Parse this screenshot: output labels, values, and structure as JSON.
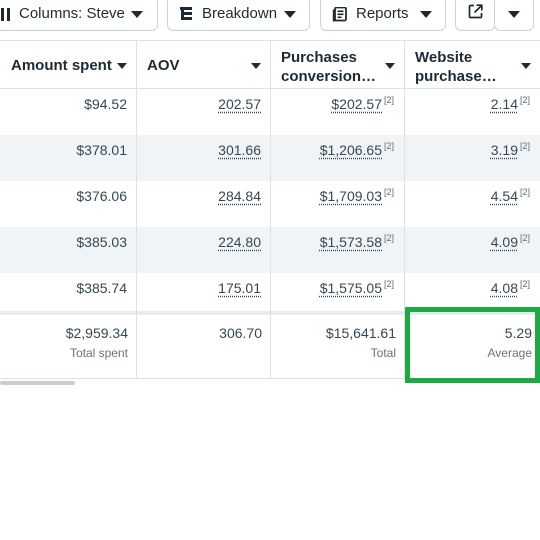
{
  "toolbar": {
    "columns_label": "Columns: Steve",
    "breakdown_label": "Breakdown",
    "reports_label": "Reports",
    "export_icon": "external-link-icon",
    "more_icon": "caret-down-icon"
  },
  "table": {
    "columns": [
      {
        "line1": "Amount spent",
        "line2": ""
      },
      {
        "line1": "AOV",
        "line2": ""
      },
      {
        "line1": "Purchases",
        "line2": "conversion…"
      },
      {
        "line1": "Website",
        "line2": "purchase…"
      }
    ],
    "rows": [
      {
        "amount": "$94.52",
        "aov": "202.57",
        "conv": "$202.57",
        "conv_note": "[2]",
        "web": "2.14",
        "web_note": "[2]"
      },
      {
        "amount": "$378.01",
        "aov": "301.66",
        "conv": "$1,206.65",
        "conv_note": "[2]",
        "web": "3.19",
        "web_note": "[2]"
      },
      {
        "amount": "$376.06",
        "aov": "284.84",
        "conv": "$1,709.03",
        "conv_note": "[2]",
        "web": "4.54",
        "web_note": "[2]"
      },
      {
        "amount": "$385.03",
        "aov": "224.80",
        "conv": "$1,573.58",
        "conv_note": "[2]",
        "web": "4.09",
        "web_note": "[2]"
      },
      {
        "amount": "$385.74",
        "aov": "175.01",
        "conv": "$1,575.05",
        "conv_note": "[2]",
        "web": "4.08",
        "web_note": "[2]"
      }
    ],
    "summary": {
      "amount": "$2,959.34",
      "amount_sub": "Total spent",
      "aov": "306.70",
      "conv": "$15,641.61",
      "conv_sub": "Total",
      "web": "5.29",
      "web_sub": "Average"
    }
  },
  "colors": {
    "highlight": "#1ea942",
    "alt_row": "#f1f4f7"
  }
}
